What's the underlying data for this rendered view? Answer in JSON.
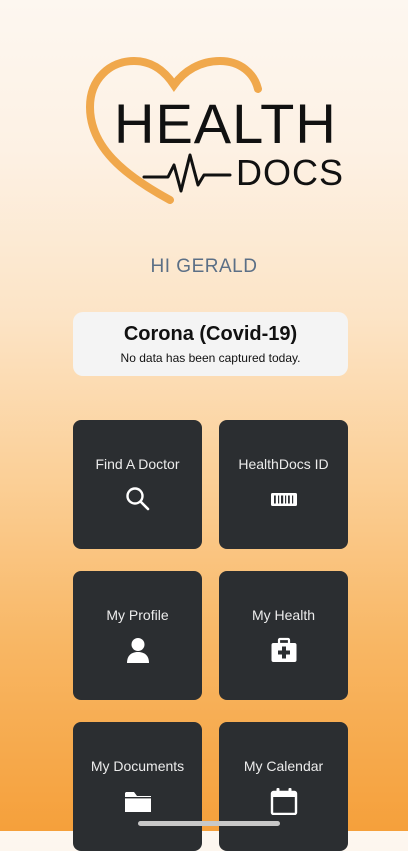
{
  "logo": {
    "word1": "HEALTH",
    "word2": "DOCS",
    "accent_color": "#f0a84c"
  },
  "greeting": "HI GERALD",
  "status_card": {
    "title": "Corona (Covid-19)",
    "subtitle": "No data has been captured today."
  },
  "tiles": [
    {
      "label": "Find A Doctor",
      "icon": "search-icon"
    },
    {
      "label": "HealthDocs ID",
      "icon": "id-card-icon"
    },
    {
      "label": "My Profile",
      "icon": "user-icon"
    },
    {
      "label": "My Health",
      "icon": "medical-kit-icon"
    },
    {
      "label": "My Documents",
      "icon": "folder-icon"
    },
    {
      "label": "My Calendar",
      "icon": "calendar-icon"
    }
  ],
  "colors": {
    "tile_bg": "#2b2e31",
    "greeting": "#5b6f86",
    "gradient_bottom": "#f5a03b"
  }
}
